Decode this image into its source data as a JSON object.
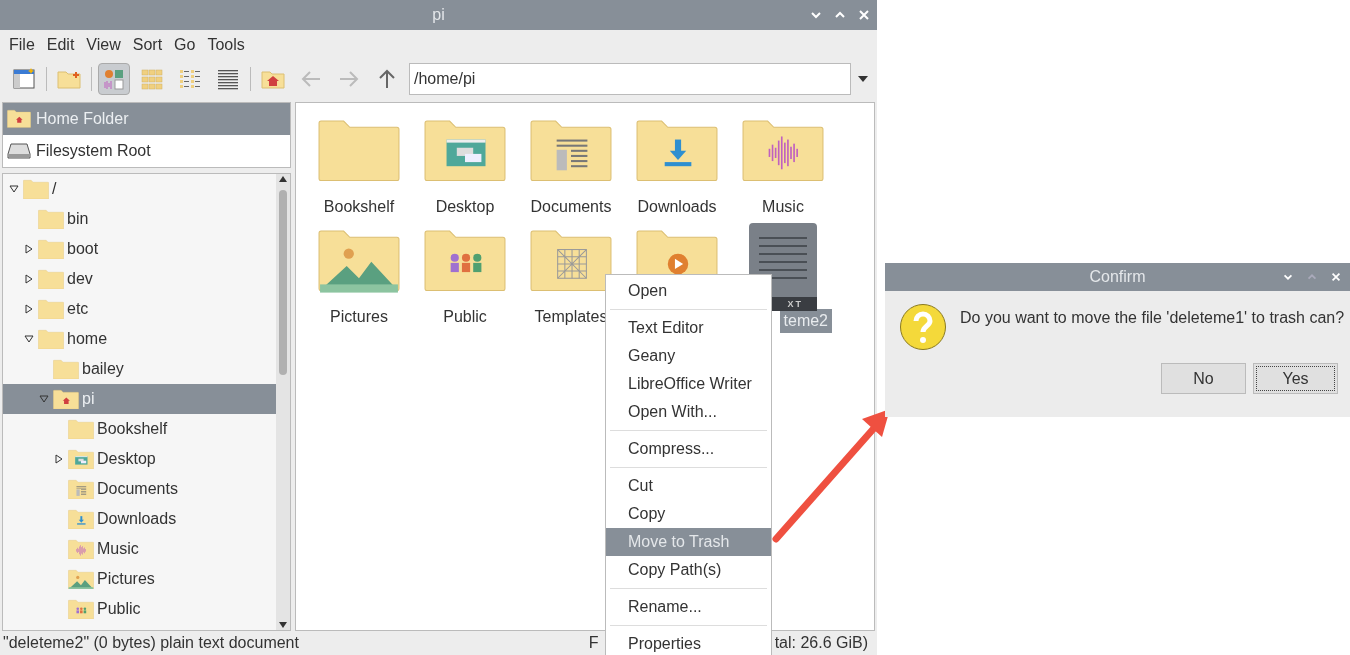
{
  "window": {
    "title": "pi"
  },
  "menubar": [
    "File",
    "Edit",
    "View",
    "Sort",
    "Go",
    "Tools"
  ],
  "toolbar": {
    "buttons": [
      {
        "kind": "new-window",
        "selected": false
      },
      {
        "kind": "new-folder",
        "selected": false
      },
      {
        "kind": "icon-view",
        "selected": true
      },
      {
        "kind": "thumbnail-view",
        "selected": false
      },
      {
        "kind": "compact-view",
        "selected": false
      },
      {
        "kind": "list-view",
        "selected": false
      },
      {
        "kind": "home",
        "selected": false
      },
      {
        "kind": "back",
        "selected": false
      },
      {
        "kind": "forward",
        "selected": false
      },
      {
        "kind": "up",
        "selected": false
      }
    ],
    "path": "/home/pi"
  },
  "places": [
    {
      "label": "Home Folder",
      "kind": "home",
      "selected": true
    },
    {
      "label": "Filesystem Root",
      "kind": "drive",
      "selected": false
    }
  ],
  "tree": [
    {
      "label": "/",
      "kind": "folder",
      "expanded": true,
      "selected": false,
      "children": [
        {
          "label": "bin",
          "kind": "folder",
          "selected": false
        },
        {
          "label": "boot",
          "kind": "folder",
          "expanded": false,
          "selected": false
        },
        {
          "label": "dev",
          "kind": "folder",
          "expanded": false,
          "selected": false
        },
        {
          "label": "etc",
          "kind": "folder",
          "expanded": false,
          "selected": false
        },
        {
          "label": "home",
          "kind": "folder",
          "expanded": true,
          "selected": false,
          "children": [
            {
              "label": "bailey",
              "kind": "folder",
              "selected": false
            },
            {
              "label": "pi",
              "kind": "home",
              "expanded": true,
              "selected": true,
              "children": [
                {
                  "label": "Bookshelf",
                  "kind": "folder",
                  "selected": false
                },
                {
                  "label": "Desktop",
                  "kind": "desktop",
                  "expanded": false,
                  "selected": false
                },
                {
                  "label": "Documents",
                  "kind": "documents",
                  "selected": false
                },
                {
                  "label": "Downloads",
                  "kind": "downloads",
                  "selected": false
                },
                {
                  "label": "Music",
                  "kind": "music",
                  "selected": false
                },
                {
                  "label": "Pictures",
                  "kind": "pictures",
                  "selected": false
                },
                {
                  "label": "Public",
                  "kind": "public",
                  "selected": false
                }
              ]
            }
          ]
        }
      ]
    }
  ],
  "files": [
    {
      "label": "Bookshelf",
      "kind": "folder",
      "selected": false
    },
    {
      "label": "Desktop",
      "kind": "desktop",
      "selected": false
    },
    {
      "label": "Documents",
      "kind": "documents",
      "selected": false
    },
    {
      "label": "Downloads",
      "kind": "downloads",
      "selected": false
    },
    {
      "label": "Music",
      "kind": "music",
      "selected": false
    },
    {
      "label": "Pictures",
      "kind": "pictures",
      "selected": false
    },
    {
      "label": "Public",
      "kind": "public",
      "selected": false
    },
    {
      "label": "Templates",
      "kind": "templates",
      "selected": false
    },
    {
      "kind": "videos",
      "selected": false
    },
    {
      "label": "teme2",
      "kind": "text",
      "icon_text": "XT",
      "selected": true
    }
  ],
  "status_bar": {
    "left": "\"deleteme2\" (0 bytes) plain text document",
    "right_fragments": [
      "F",
      "tal: 26.6 GiB)"
    ]
  },
  "context_menu": [
    [
      {
        "label": "Open",
        "selected": false
      }
    ],
    [
      {
        "label": "Text Editor",
        "selected": false
      },
      {
        "label": "Geany",
        "selected": false
      },
      {
        "label": "LibreOffice Writer",
        "selected": false
      },
      {
        "label": "Open With...",
        "selected": false
      }
    ],
    [
      {
        "label": "Compress...",
        "selected": false
      }
    ],
    [
      {
        "label": "Cut",
        "selected": false
      },
      {
        "label": "Copy",
        "selected": false
      },
      {
        "label": "Move to Trash",
        "selected": true
      },
      {
        "label": "Copy Path(s)",
        "selected": false
      }
    ],
    [
      {
        "label": "Rename...",
        "selected": false
      }
    ],
    [
      {
        "label": "Properties",
        "selected": false
      }
    ]
  ],
  "dialog": {
    "title": "Confirm",
    "message": "Do you want to move the file 'deleteme1' to trash can?",
    "buttons": [
      {
        "label": "No",
        "focused": false
      },
      {
        "label": "Yes",
        "focused": true
      }
    ]
  }
}
